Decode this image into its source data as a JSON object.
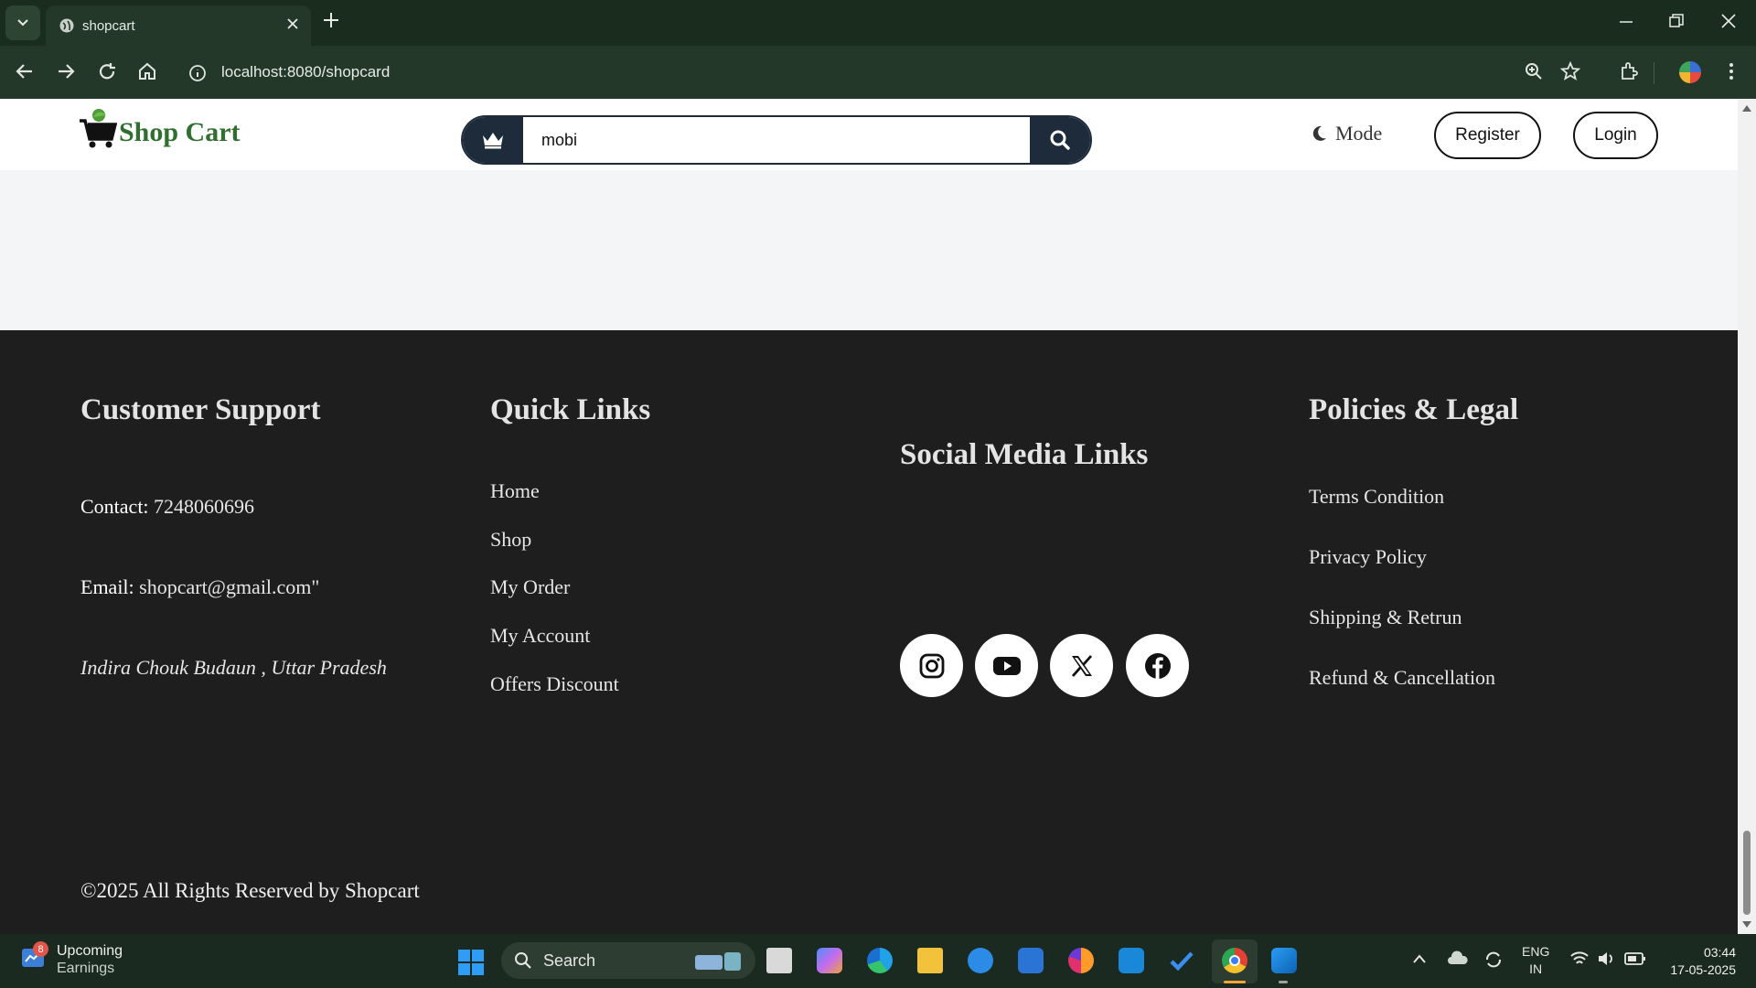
{
  "browser": {
    "tab_title": "shopcart",
    "url": "localhost:8080/shopcard"
  },
  "header": {
    "logo_text": "Shop Cart",
    "search_value": "mobi",
    "mode_label": "Mode",
    "register_label": "Register",
    "login_label": "Login"
  },
  "footer": {
    "support": {
      "title": "Customer Support",
      "contact_label": "Contact:",
      "contact_value": "7248060696",
      "email_label": "Email:",
      "email_value": "shopcart@gmail.com\"",
      "address": "Indira Chouk Budaun , Uttar Pradesh"
    },
    "quick_links": {
      "title": "Quick Links",
      "items": [
        "Home",
        "Shop",
        "My Order",
        "My Account",
        "Offers Discount"
      ]
    },
    "social": {
      "title": "Social Media Links",
      "icons": [
        "instagram-icon",
        "youtube-icon",
        "x-icon",
        "facebook-icon"
      ]
    },
    "policies": {
      "title": "Policies & Legal",
      "items": [
        "Terms Condition",
        "Privacy Policy",
        "Shipping & Retrun",
        "Refund & Cancellation"
      ]
    },
    "copyright": "©2025 All Rights Reserved by Shopcart"
  },
  "taskbar": {
    "widget_title": "Upcoming",
    "widget_subtitle": "Earnings",
    "widget_badge": "8",
    "search_label": "Search",
    "language_top": "ENG",
    "language_bottom": "IN",
    "time": "03:44",
    "date": "17-05-2025"
  },
  "colors": {
    "brand_green": "#2f6f2f",
    "navy": "#1d2b3a",
    "footer_bg": "#1e1e1e",
    "browser_frame": "#1a2c1d"
  }
}
